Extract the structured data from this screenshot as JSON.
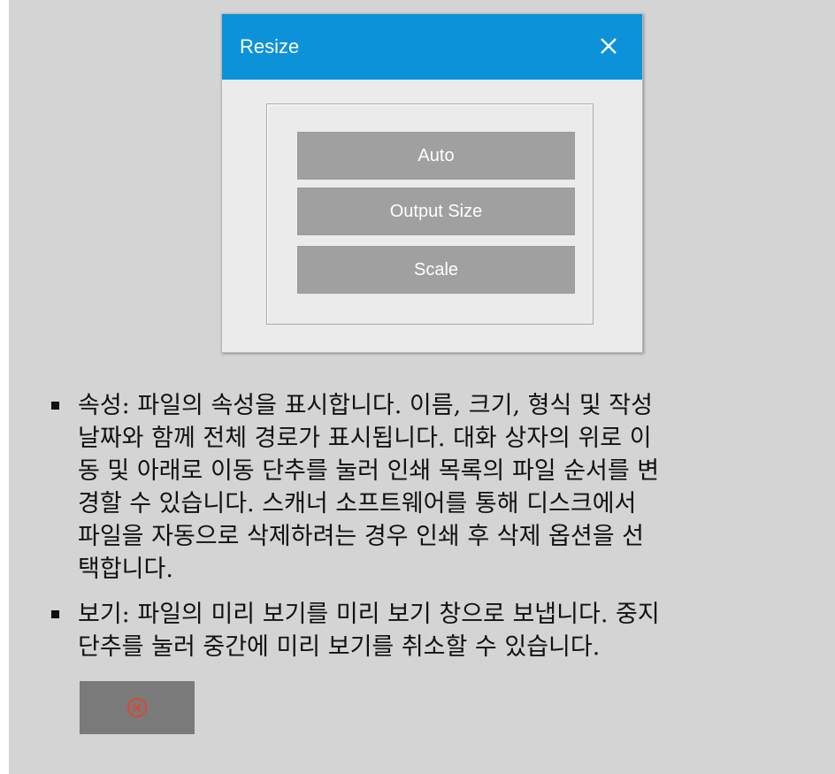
{
  "dialog": {
    "title": "Resize",
    "close_icon": "close-icon",
    "options": [
      "Auto",
      "Output Size",
      "Scale"
    ]
  },
  "bullets": [
    {
      "lines": [
        "속성: 파일의 속성을 표시합니다. 이름, 크기, 형식 및 작성",
        " 날짜와 함께 전체 경로가 표시됩니다. 대화 상자의 위로 이",
        "동 및 아래로 이동 단추를 눌러 인쇄 목록의 파일 순서를 변",
        "경할 수 있습니다. 스캐너 소프트웨어를 통해 디스크에서",
        " 파일을 자동으로 삭제하려는 경우 인쇄 후 삭제 옵션을 선",
        "택합니다."
      ]
    },
    {
      "lines": [
        "보기: 파일의 미리 보기를 미리 보기 창으로 보냅니다. 중지",
        " 단추를 눌러 중간에 미리 보기를 취소할 수 있습니다."
      ]
    }
  ],
  "stop_button": {
    "icon": "stop-circle-x-icon",
    "icon_color": "#e0452b"
  },
  "colors": {
    "titlebar": "#0c92d9",
    "panel_bg": "#d4d4d4",
    "button_bg": "#a0a0a0",
    "stop_bg": "#7a7a7a"
  }
}
